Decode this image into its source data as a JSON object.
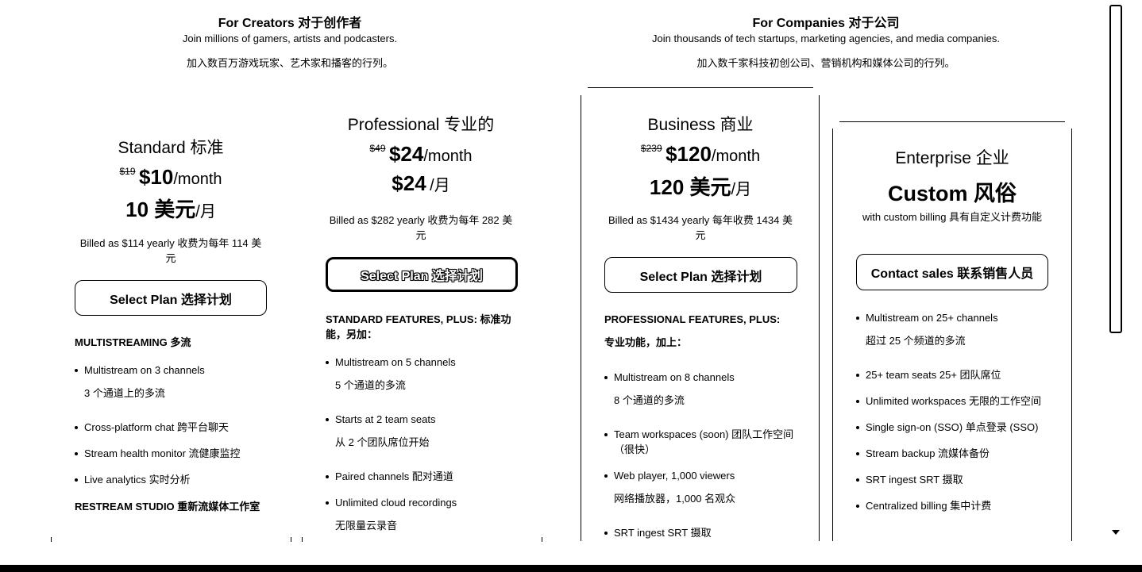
{
  "creators": {
    "title": "For Creators 对于创作者",
    "subtitle": "Join millions of gamers, artists and podcasters.",
    "subtitle_zh": "加入数百万游戏玩家、艺术家和播客的行列。"
  },
  "companies": {
    "title": "For Companies 对于公司",
    "subtitle": "Join thousands of tech startups, marketing agencies, and media companies.",
    "subtitle_zh": "加入数千家科技初创公司、营销机构和媒体公司的行列。"
  },
  "plans": {
    "standard": {
      "name": "Standard 标准",
      "old_price": "$19",
      "price": "$10",
      "per": "/month",
      "price_zh": "10 美元",
      "per_zh": "/月",
      "billed": "Billed as $114 yearly 收费为每年 114 美元",
      "button": "Select Plan 选择计划",
      "section1": "MULTISTREAMING 多流",
      "features": [
        {
          "en": "Multistream on 3 channels",
          "zh": "3 个通道上的多流"
        },
        {
          "en": "Cross-platform chat 跨平台聊天"
        },
        {
          "en": "Stream health monitor 流健康监控"
        },
        {
          "en": "Live analytics 实时分析"
        }
      ],
      "section2": "RESTREAM STUDIO 重新流媒体工作室"
    },
    "professional": {
      "name": "Professional 专业的",
      "old_price": "$49",
      "price": "$24",
      "per": "/month",
      "price_zh": "$24",
      "per_zh": "/月",
      "billed": "Billed as $282 yearly 收费为每年 282 美元",
      "button": "Select Plan 选择计划",
      "section1": "STANDARD FEATURES, PLUS: 标准功能，另加：",
      "features": [
        {
          "en": "Multistream on 5 channels",
          "zh": "5 个通道的多流"
        },
        {
          "en": "Starts at 2 team seats",
          "zh": "从 2 个团队席位开始"
        },
        {
          "en": "Paired channels 配对通道"
        },
        {
          "en": "Unlimited cloud recordings",
          "zh": "无限量云录音"
        }
      ]
    },
    "business": {
      "name": "Business 商业",
      "old_price": "$239",
      "price": "$120",
      "per": "/month",
      "price_zh": "120 美元",
      "per_zh": "/月",
      "billed": "Billed as $1434 yearly 每年收费 1434 美元",
      "button": "Select Plan 选择计划",
      "section1": "PROFESSIONAL FEATURES, PLUS:",
      "section1_zh": "专业功能，加上：",
      "features": [
        {
          "en": "Multistream on 8 channels",
          "zh": "8 个通道的多流"
        },
        {
          "en": "Team workspaces (soon) 团队工作空间（很快）"
        },
        {
          "en": "Web player, 1,000 viewers",
          "zh": "网络播放器，1,000 名观众"
        },
        {
          "en": "SRT ingest SRT 摄取"
        }
      ]
    },
    "enterprise": {
      "name": "Enterprise 企业",
      "price": "Custom 风俗",
      "billed": "with custom billing 具有自定义计费功能",
      "button": "Contact sales 联系销售人员",
      "features": [
        {
          "en": "Multistream on 25+ channels",
          "zh": "超过 25 个频道的多流"
        },
        {
          "en": "25+ team seats 25+ 团队席位"
        },
        {
          "en": "Unlimited workspaces 无限的工作空间"
        },
        {
          "en": "Single sign-on (SSO) 单点登录 (SSO)"
        },
        {
          "en": "Stream backup 流媒体备份"
        },
        {
          "en": "SRT ingest SRT 摄取"
        },
        {
          "en": "Centralized billing 集中计费"
        }
      ]
    }
  },
  "scroll": {
    "down_icon": "triangle-down-icon"
  }
}
